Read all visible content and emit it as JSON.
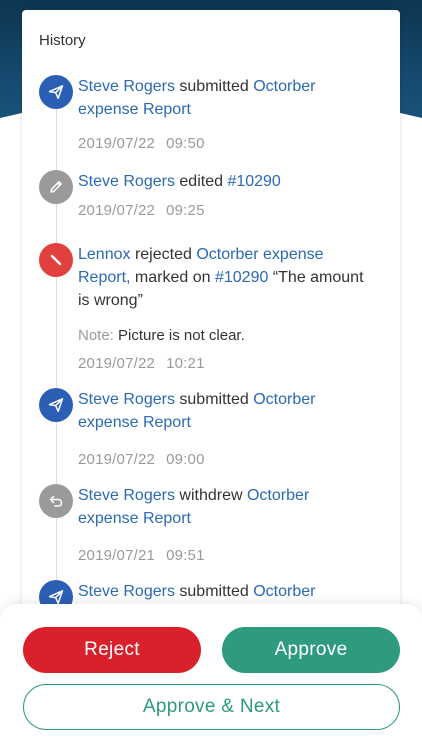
{
  "history": {
    "title": "History",
    "entries": [
      {
        "icon": "send-icon",
        "icon_color": "#2b5fb6",
        "actor": "Steve Rogers",
        "action": "submitted",
        "line1_rest": "Octorber",
        "line2": "expense Report",
        "date": "2019/07/22",
        "time": "09:50"
      },
      {
        "icon": "pencil-icon",
        "icon_color": "#9a9a9a",
        "actor": "Steve Rogers",
        "action": "edited",
        "target": "#10290",
        "date": "2019/07/22",
        "time": "09:25"
      },
      {
        "icon": "reject-icon",
        "icon_color": "#e1403f",
        "actor": "Lennox",
        "action": "rejected",
        "line1_rest": "Octorber expense",
        "line2_link": "Report,",
        "line2_text": "marked on",
        "line2_ref": "#10290",
        "line2_quote": "“The amount",
        "line3": "is wrong”",
        "note_label": "Note:",
        "note_text": "Picture is not clear.",
        "date": "2019/07/22",
        "time": "10:21"
      },
      {
        "icon": "send-icon",
        "icon_color": "#2b5fb6",
        "actor": "Steve Rogers",
        "action": "submitted",
        "line1_rest": "Octorber",
        "line2": "expense Report",
        "date": "2019/07/22",
        "time": "09:00"
      },
      {
        "icon": "undo-icon",
        "icon_color": "#9a9a9a",
        "actor": "Steve Rogers",
        "action": "withdrew",
        "line1_rest": "Octorber",
        "line2": "expense Report",
        "date": "2019/07/21",
        "time": "09:51"
      },
      {
        "icon": "send-icon",
        "icon_color": "#2b5fb6",
        "actor": "Steve Rogers",
        "action": "submitted",
        "line1_rest": "Octorber"
      }
    ]
  },
  "actions": {
    "reject_label": "Reject",
    "approve_label": "Approve",
    "approve_next_label": "Approve & Next",
    "reject_color": "#d8212a",
    "approve_color": "#2e9a7f"
  }
}
